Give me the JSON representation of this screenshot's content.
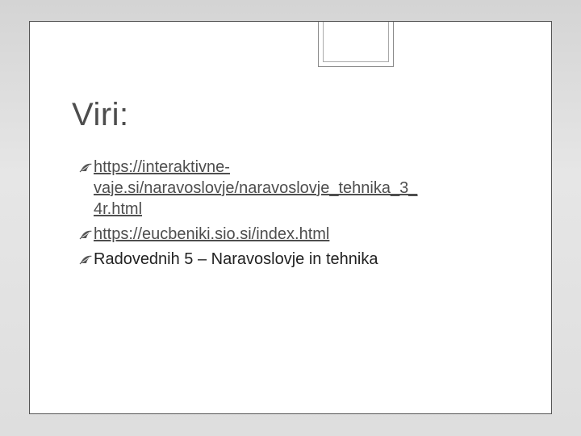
{
  "slide": {
    "title": "Viri:",
    "bullets": [
      {
        "icon": "leaf-bullet-icon",
        "lines": [
          "https://interaktivne-",
          "vaje.si/naravoslovje/naravoslovje_tehnika_3_",
          "4r.html"
        ]
      },
      {
        "icon": "leaf-bullet-icon",
        "text": "https://eucbeniki.sio.si/index.html"
      },
      {
        "icon": "leaf-bullet-icon",
        "text": "Radovednih 5 – Naravoslovje in tehnika"
      }
    ]
  },
  "colors": {
    "background": "#dedede",
    "slide": "#ffffff",
    "title": "#4d4d4d",
    "text": "#222222",
    "bullet": "#555555"
  }
}
